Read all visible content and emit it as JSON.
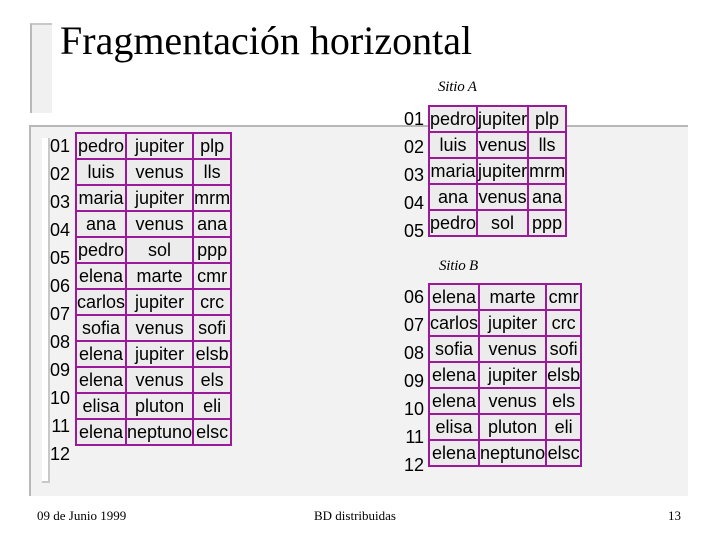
{
  "slide": {
    "title": "Fragmentación horizontal",
    "footer": {
      "date": "09 de Junio 1999",
      "course": "BD distribuidas",
      "page_number": "13"
    }
  },
  "colors": {
    "table_border": "#9a1a9a",
    "cell_background": "#ececec",
    "panel_background": "#f2f2f2"
  },
  "full_relation": {
    "rows": [
      {
        "id": "01",
        "cells": [
          "pedro",
          "jupiter",
          "plp"
        ]
      },
      {
        "id": "02",
        "cells": [
          "luis",
          "venus",
          "lls"
        ]
      },
      {
        "id": "03",
        "cells": [
          "maria",
          "jupiter",
          "mrm"
        ]
      },
      {
        "id": "04",
        "cells": [
          "ana",
          "venus",
          "ana"
        ]
      },
      {
        "id": "05",
        "cells": [
          "pedro",
          "sol",
          "ppp"
        ]
      },
      {
        "id": "06",
        "cells": [
          "elena",
          "marte",
          "cmr"
        ]
      },
      {
        "id": "07",
        "cells": [
          "carlos",
          "jupiter",
          "crc"
        ]
      },
      {
        "id": "08",
        "cells": [
          "sofia",
          "venus",
          "sofi"
        ]
      },
      {
        "id": "09",
        "cells": [
          "elena",
          "jupiter",
          "elsb"
        ]
      },
      {
        "id": "10",
        "cells": [
          "elena",
          "venus",
          "els"
        ]
      },
      {
        "id": "11",
        "cells": [
          "elisa",
          "pluton",
          "eli"
        ]
      },
      {
        "id": "12",
        "cells": [
          "elena",
          "neptuno",
          "elsc"
        ]
      }
    ]
  },
  "fragments": [
    {
      "label": "Sitio A",
      "rows": [
        {
          "id": "01",
          "cells": [
            "pedro",
            "jupiter",
            "plp"
          ]
        },
        {
          "id": "02",
          "cells": [
            "luis",
            "venus",
            "lls"
          ]
        },
        {
          "id": "03",
          "cells": [
            "maria",
            "jupiter",
            "mrm"
          ]
        },
        {
          "id": "04",
          "cells": [
            "ana",
            "venus",
            "ana"
          ]
        },
        {
          "id": "05",
          "cells": [
            "pedro",
            "sol",
            "ppp"
          ]
        }
      ]
    },
    {
      "label": "Sitio B",
      "rows": [
        {
          "id": "06",
          "cells": [
            "elena",
            "marte",
            "cmr"
          ]
        },
        {
          "id": "07",
          "cells": [
            "carlos",
            "jupiter",
            "crc"
          ]
        },
        {
          "id": "08",
          "cells": [
            "sofia",
            "venus",
            "sofi"
          ]
        },
        {
          "id": "09",
          "cells": [
            "elena",
            "jupiter",
            "elsb"
          ]
        },
        {
          "id": "10",
          "cells": [
            "elena",
            "venus",
            "els"
          ]
        },
        {
          "id": "11",
          "cells": [
            "elisa",
            "pluton",
            "eli"
          ]
        },
        {
          "id": "12",
          "cells": [
            "elena",
            "neptuno",
            "elsc"
          ]
        }
      ]
    }
  ]
}
